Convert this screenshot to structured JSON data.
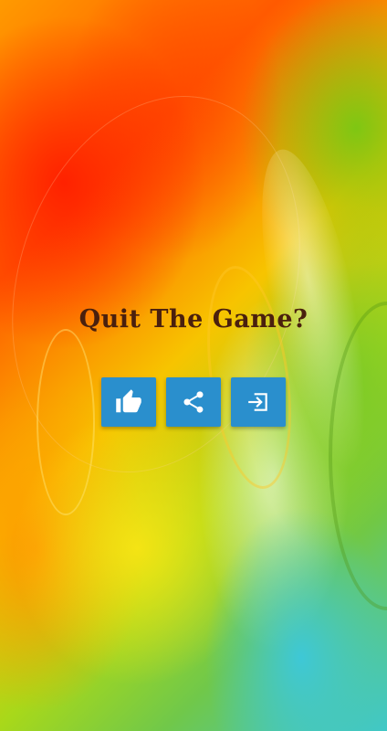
{
  "dialog": {
    "title": "Quit The Game?"
  },
  "buttons": [
    {
      "id": "like",
      "icon": "thumbs-up-icon"
    },
    {
      "id": "share",
      "icon": "share-icon"
    },
    {
      "id": "exit",
      "icon": "exit-icon"
    }
  ],
  "colors": {
    "button_bg": "#2a8fcd",
    "title_text": "#4a200e"
  }
}
